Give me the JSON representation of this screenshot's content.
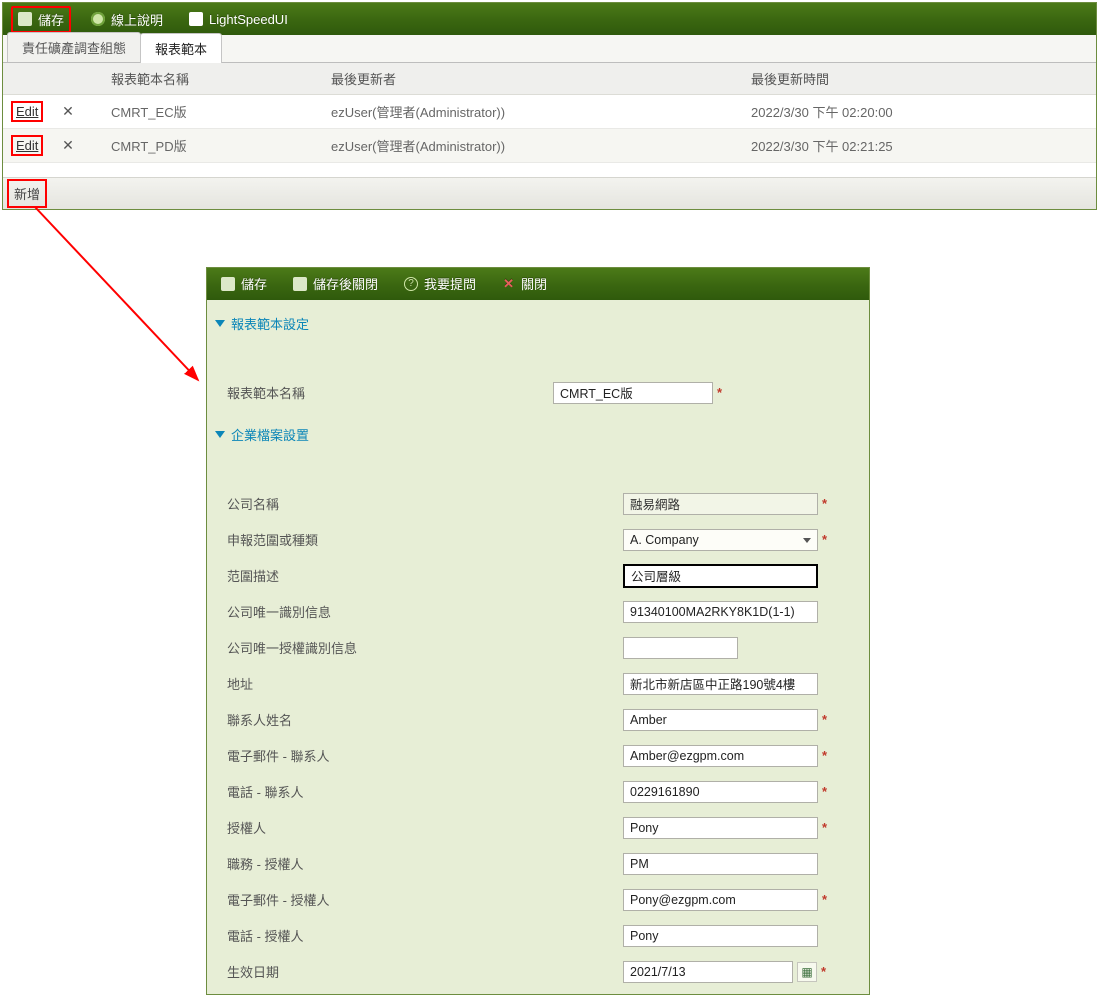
{
  "main": {
    "toolbar": {
      "save": "儲存",
      "help": "線上說明",
      "brand": "LightSpeedUI"
    },
    "tabs": [
      "責任礦產調查組態",
      "報表範本"
    ],
    "active_tab": 1,
    "columns": {
      "c1": "",
      "c2": "",
      "name": "報表範本名稱",
      "updater": "最後更新者",
      "updated": "最後更新時間"
    },
    "rows": [
      {
        "edit": "Edit",
        "del": "✕",
        "name": "CMRT_EC版",
        "updater": "ezUser(管理者(Administrator))",
        "updated": "2022/3/30 下午 02:20:00"
      },
      {
        "edit": "Edit",
        "del": "✕",
        "name": "CMRT_PD版",
        "updater": "ezUser(管理者(Administrator))",
        "updated": "2022/3/30 下午 02:21:25"
      }
    ],
    "add": "新增"
  },
  "child": {
    "toolbar": {
      "save": "儲存",
      "save_close": "儲存後關閉",
      "ask": "我要提問",
      "close": "關閉"
    },
    "section1": "報表範本設定",
    "section2": "企業檔案設置",
    "labels": {
      "tmpl_name": "報表範本名稱",
      "company": "公司名稱",
      "scope": "申報范圍或種類",
      "scope_desc": "范圍描述",
      "uid": "公司唯一識別信息",
      "auth_uid": "公司唯一授權識別信息",
      "address": "地址",
      "contact_name": "聯系人姓名",
      "contact_email": "電子郵件 - 聯系人",
      "contact_phone": "電話 - 聯系人",
      "auth_name": "授權人",
      "auth_title": "職務 - 授權人",
      "auth_email": "電子郵件 - 授權人",
      "auth_phone": "電話 - 授權人",
      "effective": "生效日期"
    },
    "values": {
      "tmpl_name": "CMRT_EC版",
      "company": "融易網路",
      "scope": "A. Company",
      "scope_desc": "公司層級",
      "uid": "91340100MA2RKY8K1D(1-1)",
      "auth_uid": "",
      "address": "新北市新店區中正路190號4樓",
      "contact_name": "Amber",
      "contact_email": "Amber@ezgpm.com",
      "contact_phone": "0229161890",
      "auth_name": "Pony",
      "auth_title": "PM",
      "auth_email": "Pony@ezgpm.com",
      "auth_phone": "Pony",
      "effective": "2021/7/13"
    },
    "req": "*"
  }
}
